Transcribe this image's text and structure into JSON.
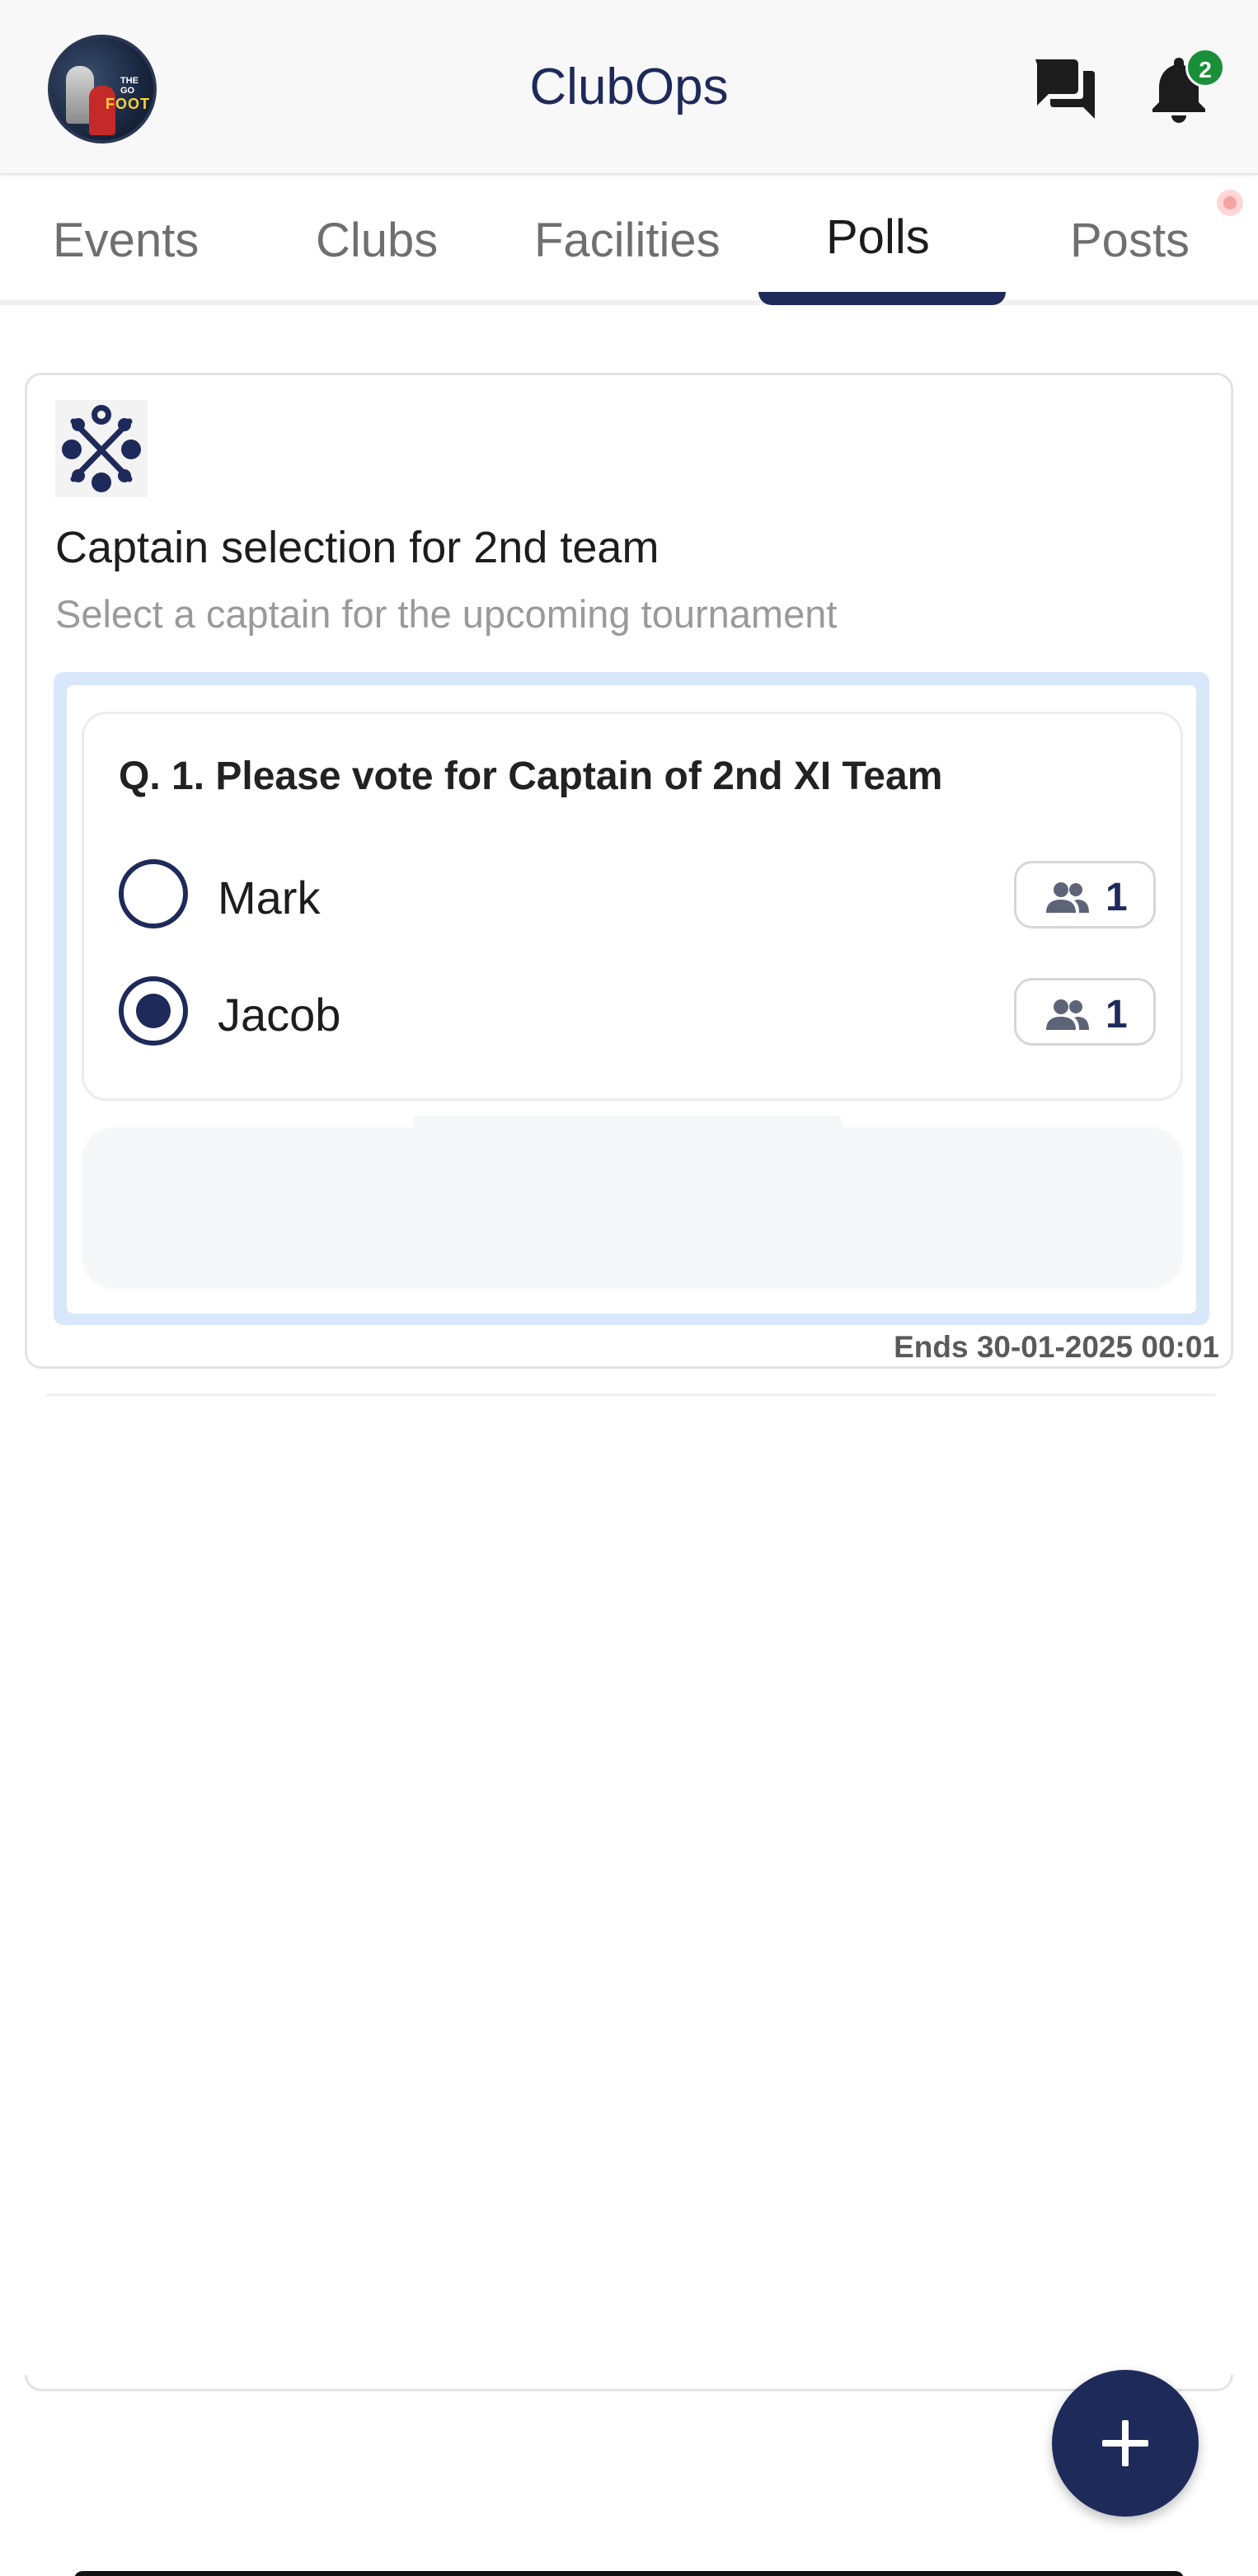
{
  "header": {
    "app_title": "ClubOps",
    "notification_count": "2",
    "avatar_text_top": "THE GO",
    "avatar_text": "FOOT"
  },
  "tabs": [
    {
      "label": "Events",
      "active": false
    },
    {
      "label": "Clubs",
      "active": false
    },
    {
      "label": "Facilities",
      "active": false
    },
    {
      "label": "Polls",
      "active": true
    },
    {
      "label": "Posts",
      "active": false
    }
  ],
  "poll": {
    "title": "Captain selection for 2nd team",
    "subtitle": "Select a captain for the upcoming tournament",
    "question": "Q. 1. Please vote for Captain of 2nd XI Team",
    "options": [
      {
        "label": "Mark",
        "votes": "1",
        "selected": false
      },
      {
        "label": "Jacob",
        "votes": "1",
        "selected": true
      }
    ],
    "ends": "Ends 30-01-2025 00:01"
  },
  "colors": {
    "primary": "#1e2a5a",
    "badge": "#1a8f3a",
    "frame": "#d9e7fb"
  },
  "icons": {
    "chat": "chat-icon",
    "bell": "bell-icon",
    "people": "people-icon",
    "add": "plus-icon"
  }
}
